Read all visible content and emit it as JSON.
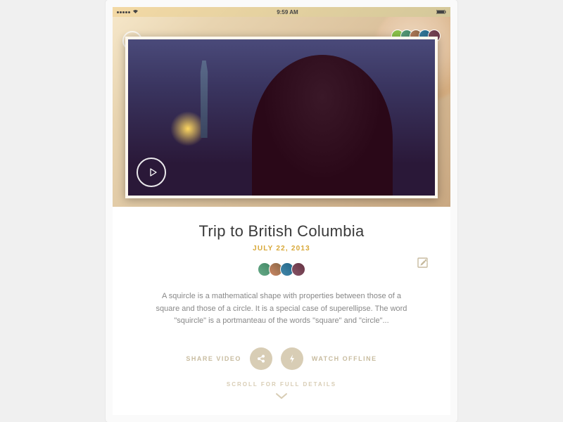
{
  "statusbar": {
    "time": "9:59 AM",
    "wifi": "wifi-icon",
    "battery": "battery-icon"
  },
  "hero": {
    "back_icon": "arrow-up",
    "play_icon": "play"
  },
  "header_avatars": [
    "av0",
    "av1",
    "av2",
    "av3",
    "av4"
  ],
  "post": {
    "title": "Trip to British Columbia",
    "date": "JULY 22, 2013",
    "description": "A squircle is a mathematical shape with properties between those of a square and those of a circle. It is a special case of superellipse. The word \"squircle\" is a portmanteau of the words \"square\" and \"circle\"..."
  },
  "participants": [
    "p1",
    "p2",
    "p3",
    "p4"
  ],
  "actions": {
    "share_label": "SHARE VIDEO",
    "watch_label": "WATCH OFFLINE"
  },
  "scroll_hint": "SCROLL FOR FULL DETAILS",
  "colors": {
    "accent": "#d8a838",
    "muted": "#c8bca0"
  }
}
